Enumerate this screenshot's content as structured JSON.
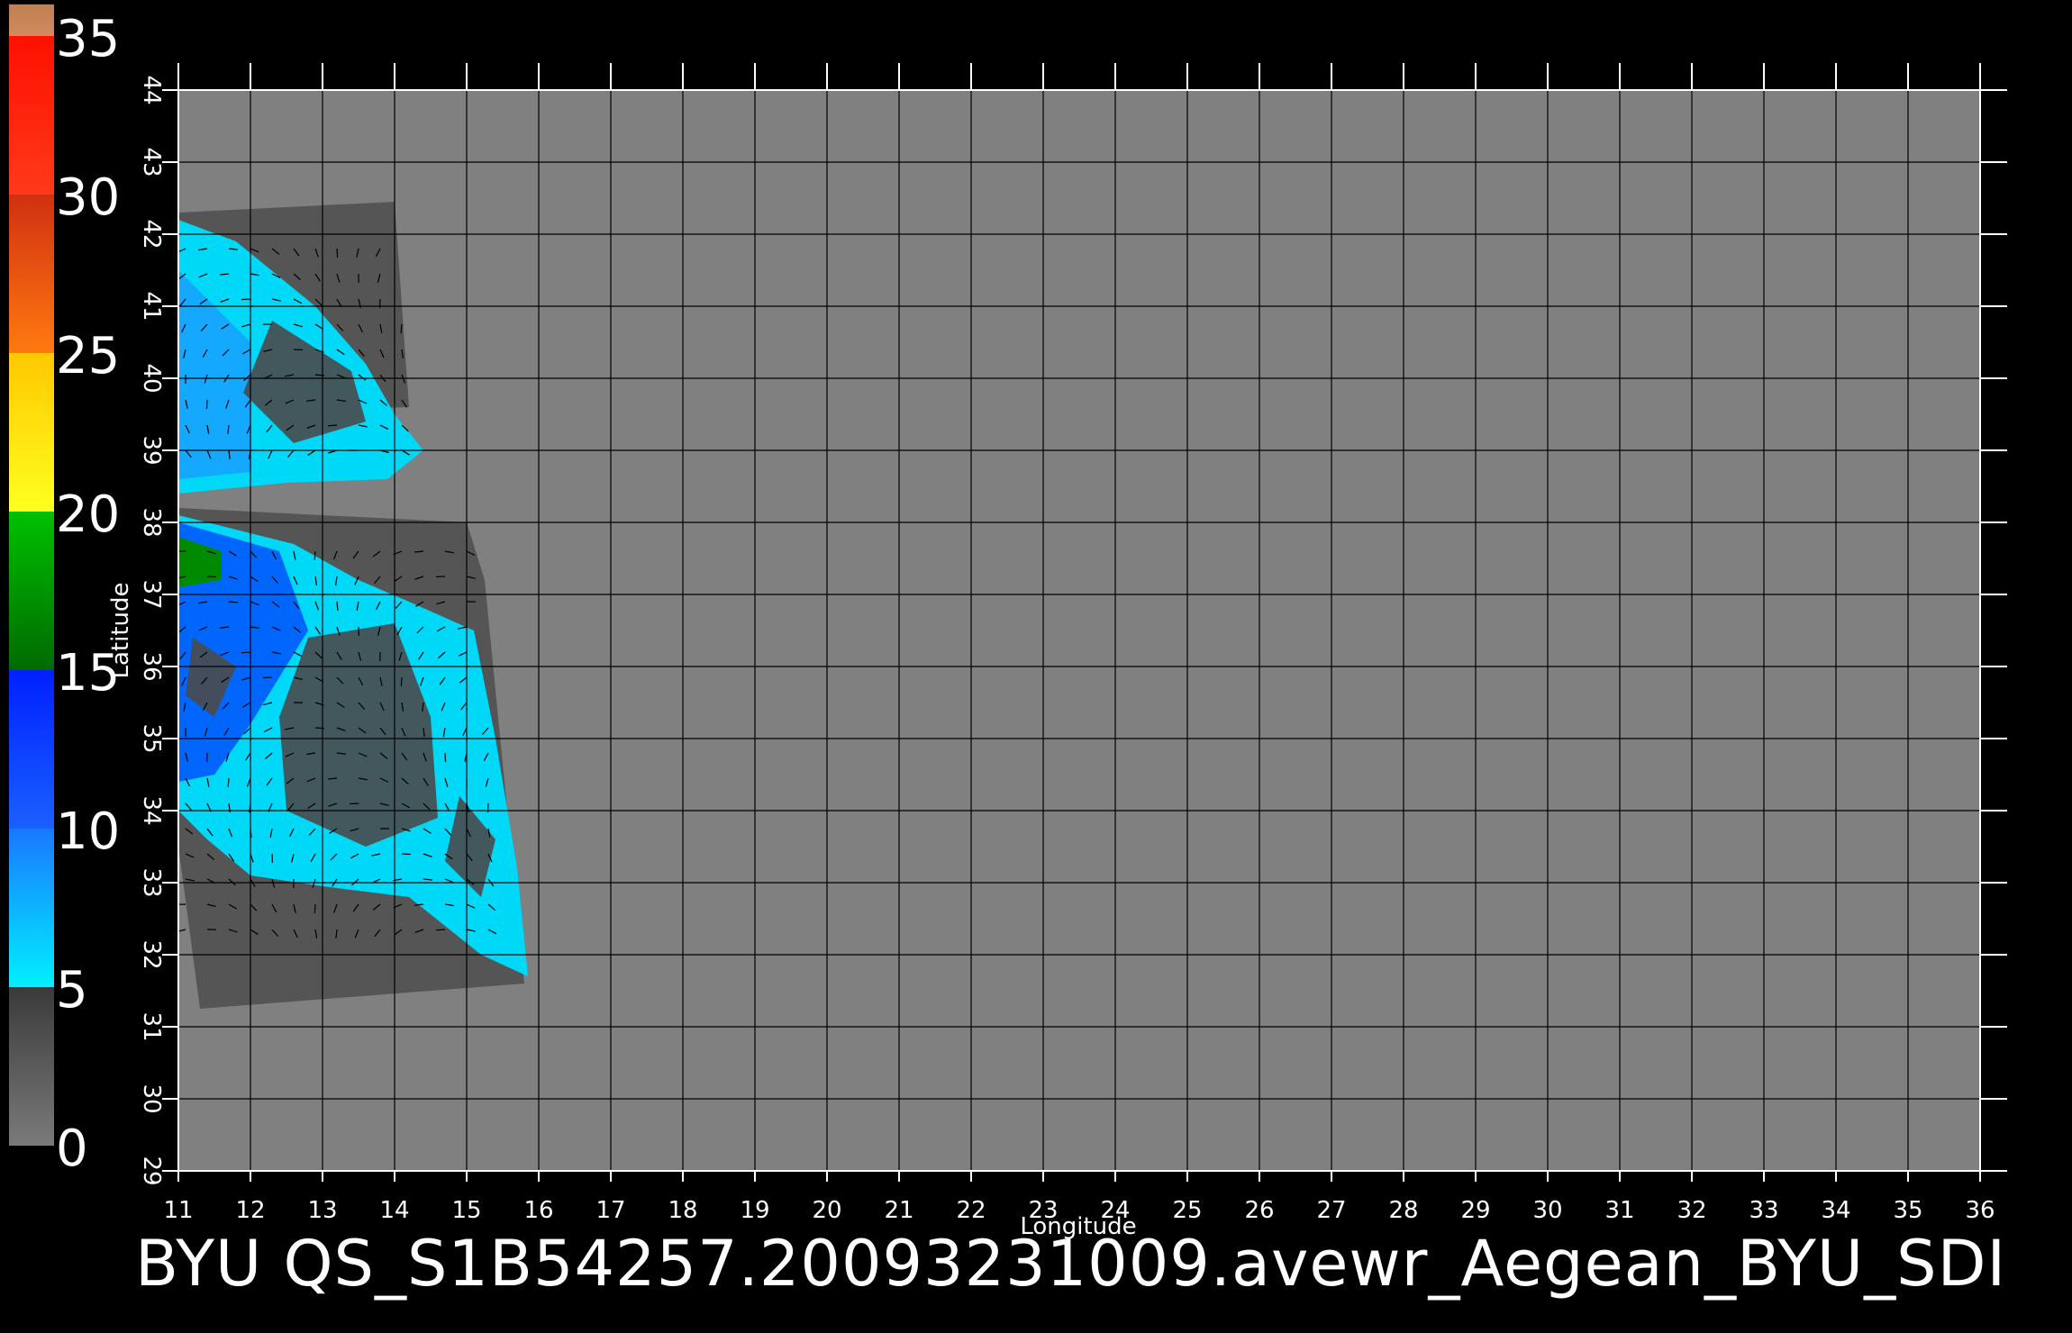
{
  "colorbar": {
    "ticks": [
      "0",
      "5",
      "10",
      "15",
      "20",
      "25",
      "30",
      "35"
    ],
    "segments": [
      {
        "from": 0,
        "to": 5,
        "top": "#3a3a3a",
        "bottom": "#7a7a7a"
      },
      {
        "from": 5,
        "to": 10,
        "top": "#1a78ff",
        "bottom": "#00f0ff"
      },
      {
        "from": 10,
        "to": 15,
        "top": "#0020ff",
        "bottom": "#1a60ff"
      },
      {
        "from": 15,
        "to": 20,
        "top": "#00c000",
        "bottom": "#006a00"
      },
      {
        "from": 20,
        "to": 25,
        "top": "#ffc800",
        "bottom": "#ffff20"
      },
      {
        "from": 25,
        "to": 30,
        "top": "#d03010",
        "bottom": "#ff7a10"
      },
      {
        "from": 30,
        "to": 35,
        "top": "#ff1000",
        "bottom": "#ff3a1a"
      },
      {
        "from": 35,
        "to": 36,
        "top": "#c08050",
        "bottom": "#d08a60"
      }
    ]
  },
  "map": {
    "xlabel": "Longitude",
    "ylabel": "Latitude",
    "lon_range": [
      11,
      36
    ],
    "lat_range": [
      29,
      44
    ],
    "lon_ticks": [
      "11",
      "12",
      "13",
      "14",
      "15",
      "16",
      "17",
      "18",
      "19",
      "20",
      "21",
      "22",
      "23",
      "24",
      "25",
      "26",
      "27",
      "28",
      "29",
      "30",
      "31",
      "32",
      "33",
      "34",
      "35",
      "36"
    ],
    "lat_ticks": [
      "29",
      "30",
      "31",
      "32",
      "33",
      "34",
      "35",
      "36",
      "37",
      "38",
      "39",
      "40",
      "41",
      "42",
      "43",
      "44"
    ],
    "background_color": "#808080",
    "swath_color": "#555555",
    "wind_colors": [
      "#00d8f8",
      "#18a0ff",
      "#0040ff"
    ]
  },
  "caption": "BYU  QS_S1B54257.20093231009.avewr_Aegean_BYU_SDI"
}
